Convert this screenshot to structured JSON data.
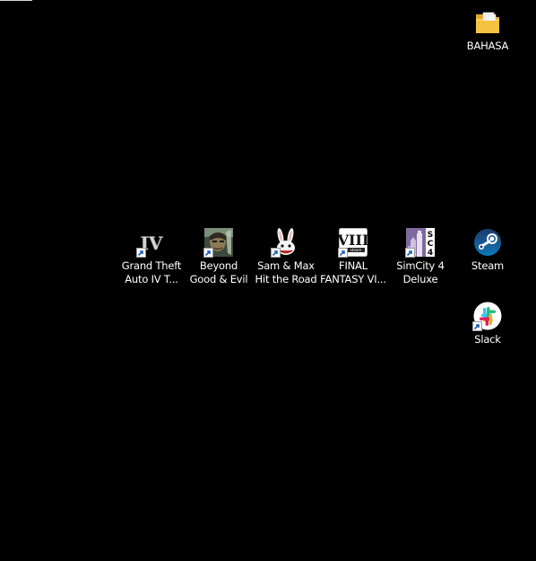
{
  "desktop": {
    "background_color": "#000000",
    "icons": {
      "bahasa": {
        "line1": "BAHASA",
        "line2": "",
        "icon": "folder-icon"
      },
      "gta4": {
        "line1": "Grand Theft",
        "line2": "Auto IV T...",
        "icon": "gta-iv-icon",
        "shortcut": true
      },
      "beyond": {
        "line1": "Beyond",
        "line2": "Good & Evil",
        "icon": "beyond-good-evil-icon",
        "shortcut": true
      },
      "sammax": {
        "line1": "Sam & Max",
        "line2": "Hit the Road",
        "icon": "sam-max-icon",
        "shortcut": true
      },
      "ff8": {
        "line1": "FINAL",
        "line2": "FANTASY VI...",
        "icon": "final-fantasy-viii-icon",
        "shortcut": true
      },
      "simcity": {
        "line1": "SimCity 4",
        "line2": "Deluxe",
        "icon": "simcity-4-icon",
        "shortcut": true
      },
      "steam": {
        "line1": "Steam",
        "line2": "",
        "icon": "steam-icon",
        "shortcut": false
      },
      "slack": {
        "line1": "Slack",
        "line2": "",
        "icon": "slack-icon",
        "shortcut": true
      }
    }
  }
}
